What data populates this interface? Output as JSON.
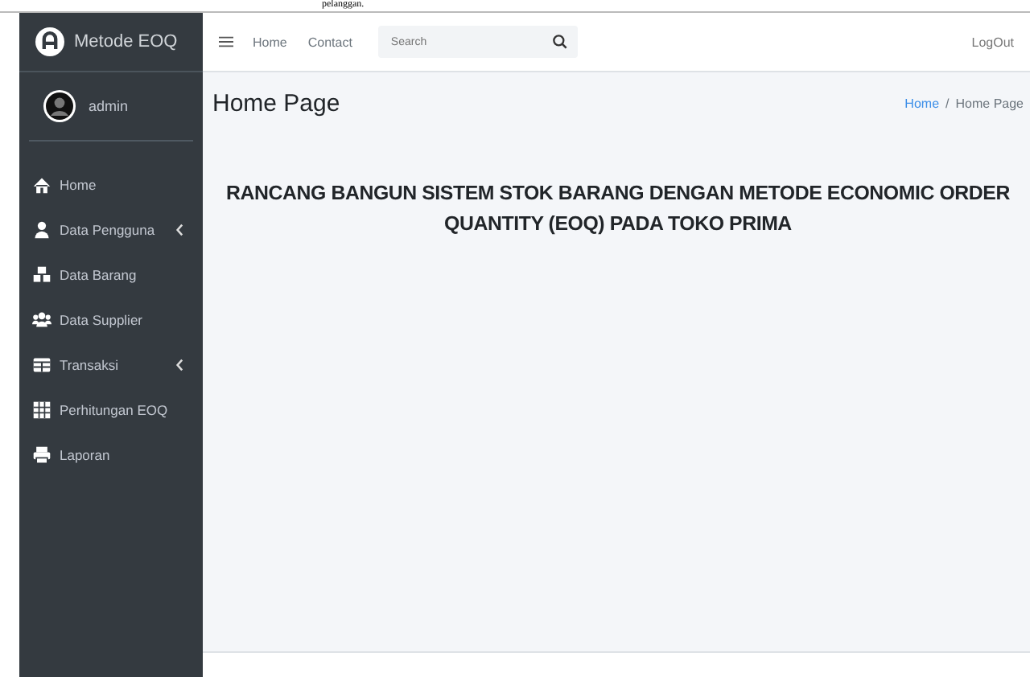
{
  "document_text": "pelanggan.",
  "sidebar": {
    "brand": "Metode EOQ",
    "user": "admin",
    "items": [
      {
        "label": "Home",
        "has_submenu": false
      },
      {
        "label": "Data Pengguna",
        "has_submenu": true
      },
      {
        "label": "Data Barang",
        "has_submenu": false
      },
      {
        "label": "Data Supplier",
        "has_submenu": false
      },
      {
        "label": "Transaksi",
        "has_submenu": true
      },
      {
        "label": "Perhitungan EOQ",
        "has_submenu": false
      },
      {
        "label": "Laporan",
        "has_submenu": false
      }
    ]
  },
  "navbar": {
    "links": [
      "Home",
      "Contact"
    ],
    "search": {
      "placeholder": "Search"
    },
    "logout": "LogOut"
  },
  "page": {
    "title": "Home Page",
    "breadcrumb": [
      "Home",
      "Home Page"
    ],
    "breadcrumb_separator": "/",
    "heading": "RANCANG BANGUN SISTEM STOK BARANG DENGAN METODE ECONOMIC ORDER QUANTITY (EOQ) PADA TOKO PRIMA"
  }
}
